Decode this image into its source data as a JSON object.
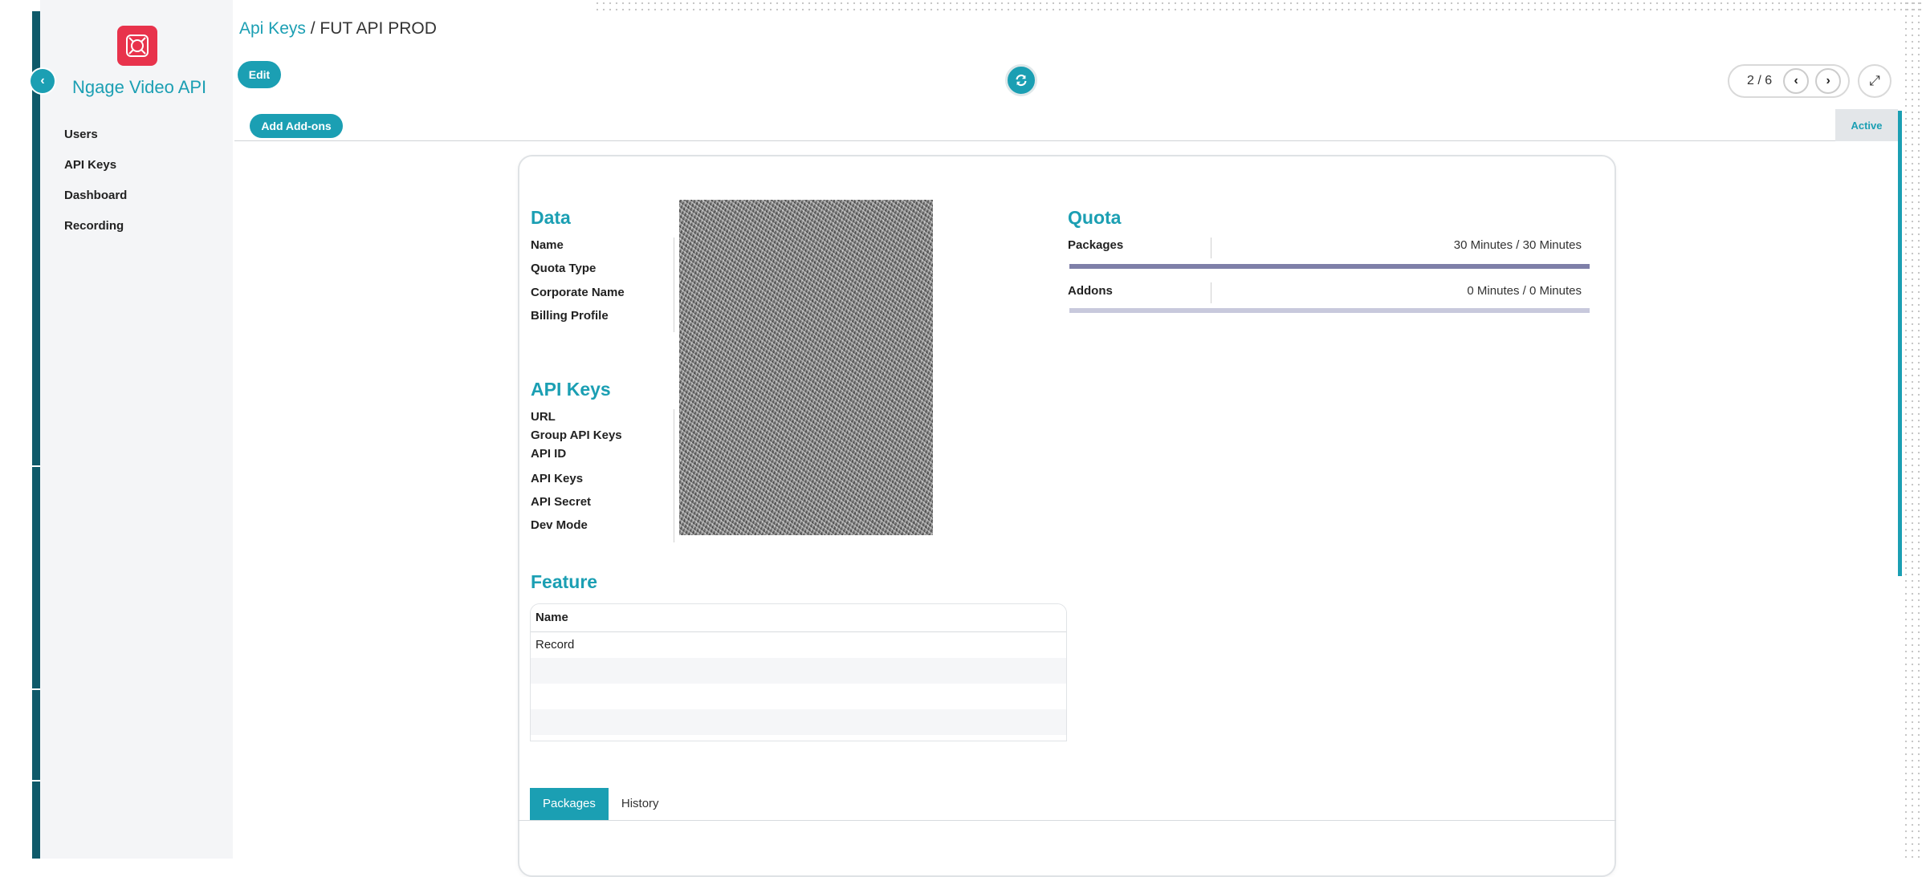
{
  "sidebar": {
    "app_name": "Ngage Video API",
    "collapse_icon": "chevron-left-icon",
    "logo_icon": "brand-logo-icon",
    "items": [
      {
        "label": "Users"
      },
      {
        "label": "API Keys"
      },
      {
        "label": "Dashboard"
      },
      {
        "label": "Recording"
      }
    ]
  },
  "breadcrumb": {
    "parent": "Api Keys",
    "separator": " / ",
    "current": "FUT API PROD"
  },
  "toolbar": {
    "edit_label": "Edit",
    "add_addons_label": "Add Add-ons",
    "sync_icon": "sync-icon",
    "pager_text": "2 / 6",
    "prev_icon": "chevron-left-icon",
    "next_icon": "chevron-right-icon",
    "expand_icon": "expand-icon"
  },
  "status": {
    "label": "Active"
  },
  "data_section": {
    "title": "Data",
    "fields": [
      "Name",
      "Quota Type",
      "Corporate Name",
      "Billing Profile"
    ]
  },
  "api_keys_section": {
    "title": "API Keys",
    "fields": [
      "URL",
      "Group API Keys",
      "API ID",
      "API Keys",
      "API Secret",
      "Dev Mode"
    ]
  },
  "quota_section": {
    "title": "Quota",
    "rows": [
      {
        "label": "Packages",
        "value": "30 Minutes / 30 Minutes",
        "fraction": 1.0
      },
      {
        "label": "Addons",
        "value": "0 Minutes / 0 Minutes",
        "fraction": 0.0
      }
    ]
  },
  "feature_section": {
    "title": "Feature",
    "column": "Name",
    "rows": [
      "Record"
    ]
  },
  "tabs": [
    {
      "label": "Packages",
      "active": true
    },
    {
      "label": "History",
      "active": false
    }
  ],
  "colors": {
    "accent": "#1b9fb3",
    "brand": "#e8334c",
    "progress": "#7e7fa8"
  }
}
